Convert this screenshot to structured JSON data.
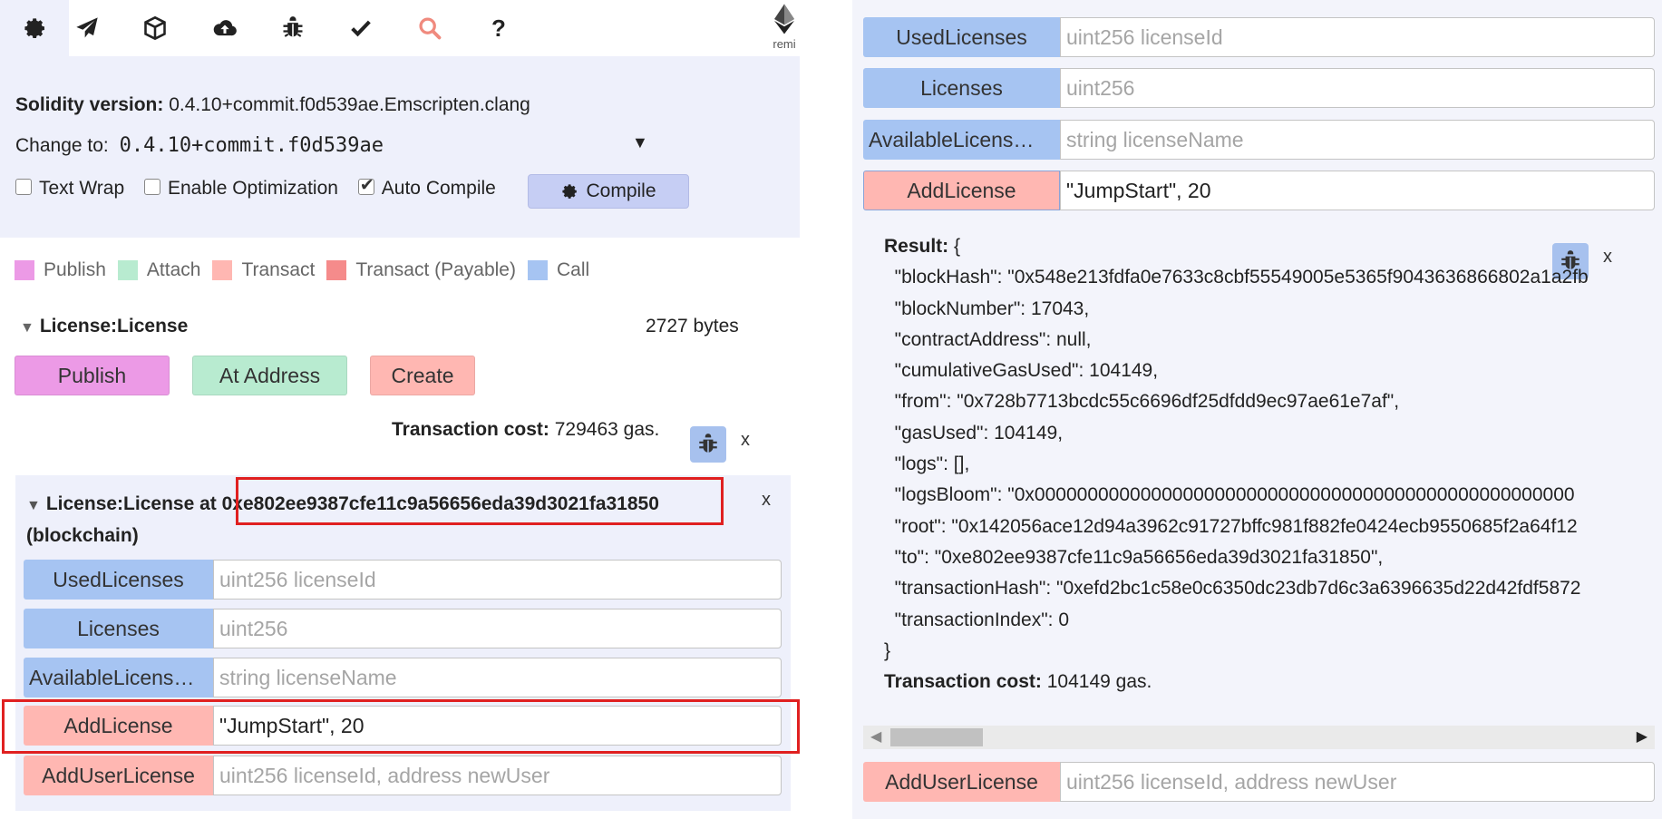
{
  "colors": {
    "publish": "#ec9ae6",
    "attach": "#b8ebd0",
    "transact": "#ffb7b2",
    "transact_payable": "#f58b8b",
    "call": "#a6c4f2",
    "highlight": "#e02020"
  },
  "toolbar": {
    "tabs": [
      {
        "icon": "gear-icon"
      },
      {
        "icon": "paper-plane-icon"
      },
      {
        "icon": "cube-icon"
      },
      {
        "icon": "cloud-upload-icon"
      },
      {
        "icon": "bug-icon"
      },
      {
        "icon": "checkmark-icon"
      },
      {
        "icon": "search-icon"
      },
      {
        "icon": "question-icon",
        "label": "?"
      }
    ],
    "brand": "remi"
  },
  "settings": {
    "solidity_label": "Solidity version:",
    "solidity_value": "0.4.10+commit.f0d539ae.Emscripten.clang",
    "change_label": "Change to:",
    "change_value": "0.4.10+commit.f0d539ae",
    "text_wrap": "Text Wrap",
    "enable_opt": "Enable Optimization",
    "auto_compile": "Auto Compile",
    "compile": "Compile"
  },
  "legend": {
    "publish": "Publish",
    "attach": "Attach",
    "transact": "Transact",
    "payable": "Transact (Payable)",
    "call": "Call"
  },
  "contract": {
    "name": "License:License",
    "size": "2727 bytes",
    "publish": "Publish",
    "at_address": "At Address",
    "create": "Create",
    "tx_cost_label": "Transaction cost:",
    "tx_cost_value": "729463 gas.",
    "close": "x"
  },
  "instance": {
    "prefix": "License:License at",
    "address": "0xe802ee9387cfe11c9a56656eda39d3021fa31850",
    "suffix": "(blockchain)",
    "close": "x",
    "functions": [
      {
        "name": "UsedLicenses",
        "placeholder": "uint256 licenseId",
        "value": ""
      },
      {
        "name": "Licenses",
        "placeholder": "uint256",
        "value": ""
      },
      {
        "name": "AvailableLicens…",
        "placeholder": "string licenseName",
        "value": ""
      },
      {
        "name": "AddLicense",
        "placeholder": "",
        "value": "\"JumpStart\", 20"
      },
      {
        "name": "AddUserLicense",
        "placeholder": "uint256 licenseId, address newUser",
        "value": ""
      }
    ]
  },
  "result": {
    "label": "Result:",
    "open": " {",
    "lines": [
      "  \"blockHash\": \"0x548e213fdfa0e7633c8cbf55549005e5365f9043636866802a1a2fb",
      "  \"blockNumber\": 17043,",
      "  \"contractAddress\": null,",
      "  \"cumulativeGasUsed\": 104149,",
      "  \"from\": \"0x728b7713bcdc55c6696df25dfdd9ec97ae61e7af\",",
      "  \"gasUsed\": 104149,",
      "  \"logs\": [],",
      "  \"logsBloom\": \"0x000000000000000000000000000000000000000000000000000",
      "  \"root\": \"0x142056ace12d94a3962c91727bffc981f882fe0424ecb9550685f2a64f12",
      "  \"to\": \"0xe802ee9387cfe11c9a56656eda39d3021fa31850\",",
      "  \"transactionHash\": \"0xefd2bc1c58e0c6350dc23db7d6c3a6396635d22d42fdf5872",
      "  \"transactionIndex\": 0"
    ],
    "close_brace": "}",
    "tx_cost_label": "Transaction cost:",
    "tx_cost_value": "104149 gas.",
    "close": "x"
  }
}
